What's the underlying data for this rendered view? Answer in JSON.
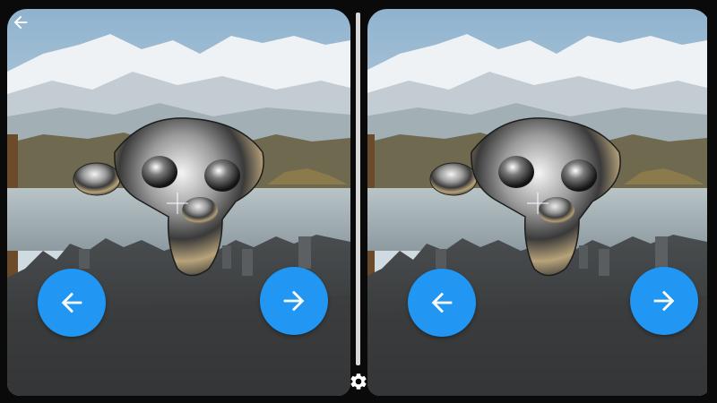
{
  "app": {
    "mode": "stereo-vr-viewer",
    "colors": {
      "accent": "#2196F3",
      "arrow": "#ffffff",
      "divider": "#d8d8d8",
      "frame": "#0a0a0a"
    }
  },
  "toolbar": {
    "back_icon": "arrow-left-icon",
    "settings_icon": "gear-icon"
  },
  "left_eye": {
    "prev_icon": "arrow-left-icon",
    "next_icon": "arrow-right-icon"
  },
  "right_eye": {
    "prev_icon": "arrow-left-icon",
    "next_icon": "arrow-right-icon"
  },
  "scene": {
    "subject": "chrome-monkey-head",
    "background": "mountain-lake-city-panorama"
  }
}
